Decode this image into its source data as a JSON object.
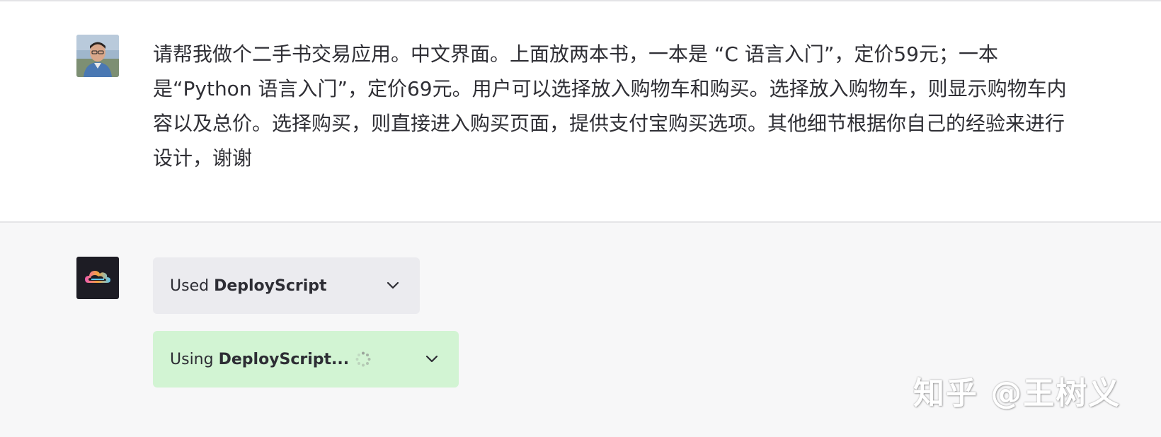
{
  "user_message": {
    "text": "请帮我做个二手书交易应用。中文界面。上面放两本书，一本是 “C 语言入门”，定价59元；一本是“Python 语言入门”，定价69元。用户可以选择放入购物车和购买。选择放入购物车，则显示购物车内容以及总价。选择购买，则直接进入购买页面，提供支付宝购买选项。其他细节根据你自己的经验来进行设计，谢谢"
  },
  "assistant": {
    "tool_used": {
      "prefix": "Used",
      "name": "DeployScript"
    },
    "tool_using": {
      "prefix": "Using",
      "name": "DeployScript..."
    }
  },
  "watermark": {
    "text": "知乎 @王树义"
  },
  "colors": {
    "page_bg": "#f7f7f8",
    "user_bg": "#ffffff",
    "used_pill_bg": "#ebebef",
    "using_pill_bg": "#d2f4d3",
    "text": "#2f2f35"
  },
  "icons": {
    "user_avatar": "user-photo-avatar",
    "bot_avatar": "deployscript-cloud-logo",
    "chevron": "chevron-down-icon",
    "spinner": "loading-spinner-icon"
  }
}
